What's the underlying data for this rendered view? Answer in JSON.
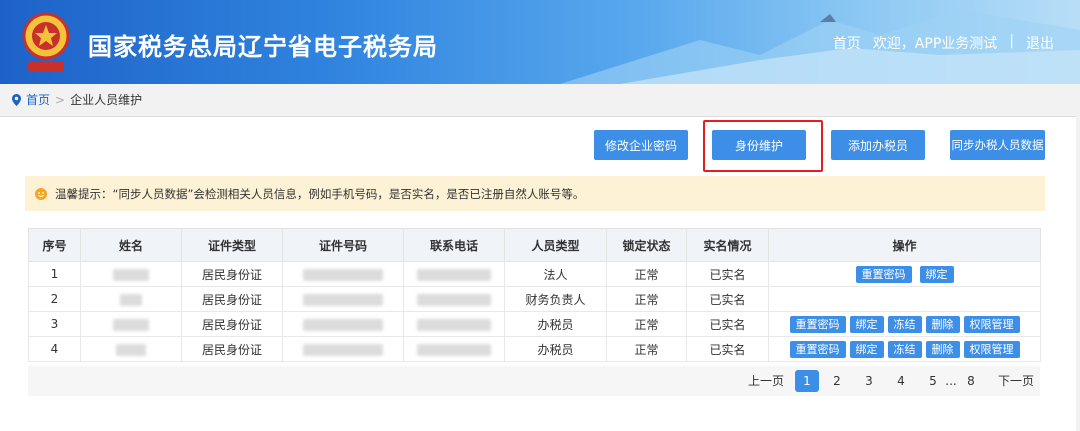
{
  "header": {
    "title": "国家税务总局辽宁省电子税务局",
    "nav": {
      "home": "首页",
      "welcome": "欢迎，APP业务测试",
      "sep": "|",
      "logout": "退出"
    }
  },
  "breadcrumb": {
    "home": "首页",
    "sep": ">",
    "current": "企业人员维护"
  },
  "toolbar": {
    "change_password": "修改企业密码",
    "identity_maintenance": "身份维护",
    "add_taxpayer": "添加办税员",
    "sync_data": "同步办税人员数据"
  },
  "tip": {
    "text": "温馨提示：“同步人员数据”会检测相关人员信息，例如手机号码，是否实名，是否已注册自然人账号等。"
  },
  "table": {
    "headers": [
      "序号",
      "姓名",
      "证件类型",
      "证件号码",
      "联系电话",
      "人员类型",
      "锁定状态",
      "实名情况",
      "操作"
    ],
    "rows": [
      {
        "no": "1",
        "id_type": "居民身份证",
        "role": "法人",
        "lock": "正常",
        "realname": "已实名",
        "ops": [
          "重置密码",
          "绑定"
        ]
      },
      {
        "no": "2",
        "id_type": "居民身份证",
        "role": "财务负责人",
        "lock": "正常",
        "realname": "已实名",
        "ops": []
      },
      {
        "no": "3",
        "id_type": "居民身份证",
        "role": "办税员",
        "lock": "正常",
        "realname": "已实名",
        "ops": [
          "重置密码",
          "绑定",
          "冻结",
          "删除",
          "权限管理"
        ]
      },
      {
        "no": "4",
        "id_type": "居民身份证",
        "role": "办税员",
        "lock": "正常",
        "realname": "已实名",
        "ops": [
          "重置密码",
          "绑定",
          "冻结",
          "删除",
          "权限管理"
        ]
      }
    ]
  },
  "pager": {
    "prev": "上一页",
    "pages": [
      "1",
      "2",
      "3",
      "4",
      "5"
    ],
    "ellipsis": "...",
    "last": "8",
    "next": "下一页",
    "current": "1"
  },
  "colors": {
    "primary": "#3d8ee6",
    "header": "#1e62c8",
    "tip_bg": "#fdf2d5",
    "highlight": "#e02020"
  },
  "icons": {
    "logo": "tax-emblem-icon",
    "location": "location-pin-icon",
    "tip": "smile-icon"
  }
}
